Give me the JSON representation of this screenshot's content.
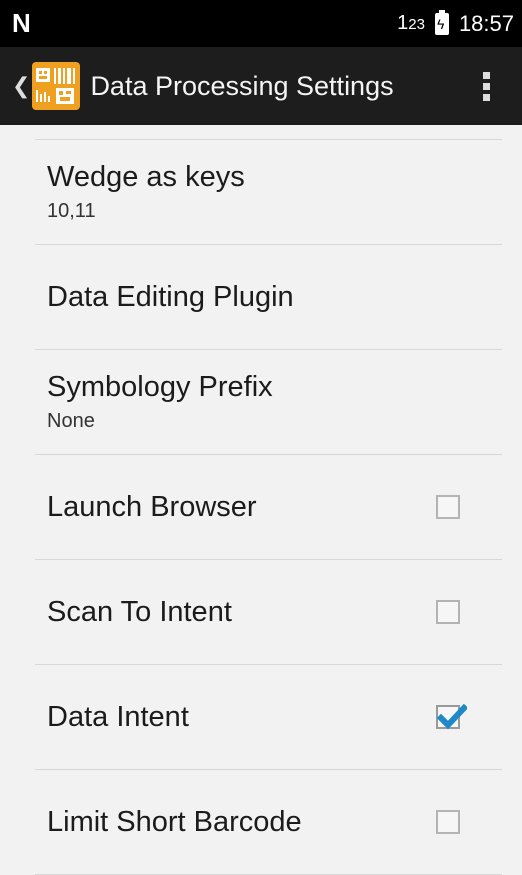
{
  "status_bar": {
    "carrier_icon": "N",
    "network": "1",
    "network_small": "23",
    "battery_icon": "battery-charging-icon",
    "time": "18:57"
  },
  "app_bar": {
    "title": "Data Processing Settings",
    "icon": "barcode-app-icon"
  },
  "preferences": [
    {
      "title": "Wedge as keys",
      "summary": "10,11"
    },
    {
      "title": "Data Editing Plugin",
      "summary": ""
    },
    {
      "title": "Symbology Prefix",
      "summary": "None"
    },
    {
      "title": "Launch Browser",
      "checked": false
    },
    {
      "title": "Scan To Intent",
      "checked": false
    },
    {
      "title": "Data Intent",
      "checked": true
    },
    {
      "title": "Limit Short Barcode",
      "checked": false
    }
  ],
  "colors": {
    "check_accent": "#1e88c8",
    "app_icon": "#f0a020"
  }
}
